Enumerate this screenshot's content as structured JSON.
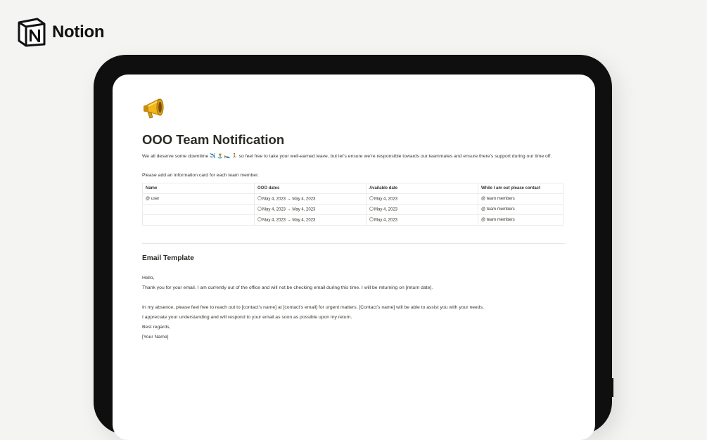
{
  "brand": {
    "name": "Notion",
    "logo_icon": "notion-logo-icon"
  },
  "page": {
    "icon": "megaphone-icon",
    "title": "OOO Team Notification",
    "intro_before": "We all deserve some downtime",
    "intro_emojis": "✈️ 🏝️ 🛌 🏃",
    "intro_after": "so feel free to take your well-earned leave, but let’s ensure we’re responsible towards our teammates and ensure there’s support during our time off.",
    "instruction": "Please add an information card for each team member."
  },
  "table": {
    "headers": [
      "Name",
      "OOO dates",
      "Available date",
      "While I am out please contact"
    ],
    "rows": [
      {
        "name": "@ user",
        "ooo_dates": "May 4, 2023 → May 4, 2023",
        "available": "May 4, 2023",
        "contact": "@ team members"
      },
      {
        "name": "",
        "ooo_dates": "May 4, 2023 → May 4, 2023",
        "available": "May 4, 2023",
        "contact": "@ team members"
      },
      {
        "name": "",
        "ooo_dates": "May 4, 2023 → May 4, 2023",
        "available": "May 4, 2023",
        "contact": "@ team members"
      }
    ]
  },
  "email": {
    "heading": "Email Template",
    "lines": [
      "Hello,",
      "Thank you for your email. I am currently out of the office and will not be checking email during this time. I will be returning on [return date].",
      "In my absence, please feel free to reach out to [contact’s name] at [contact’s email] for urgent matters. [Contact’s name] will be able to assist you with your needs.",
      "I appreciate your understanding and will respond to your email as soon as possible upon my return.",
      "Best regards,",
      "[Your Name]"
    ]
  },
  "colors": {
    "background": "#f4f4f3",
    "device_frame": "#0f0f0f",
    "page": "#ffffff",
    "text": "#37352f",
    "border": "#ebebea"
  }
}
